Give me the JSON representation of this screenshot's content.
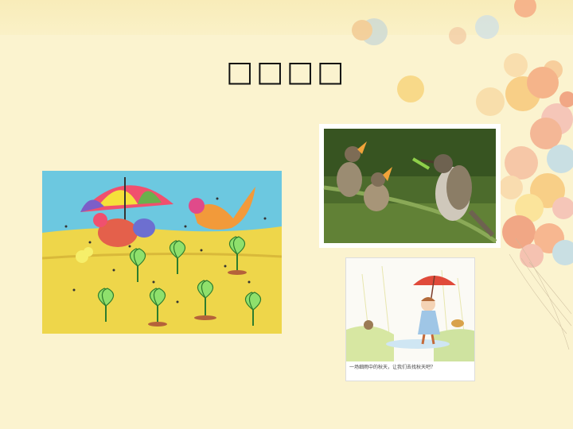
{
  "slide": {
    "title": "□□□□",
    "colors": {
      "background": "#fbf3cf",
      "band": "#f8ecb9",
      "bokeh": [
        "#f6a37c",
        "#f7c470",
        "#fbe08a",
        "#b9d9ea",
        "#f4b7b1",
        "#ee8e6d"
      ]
    }
  },
  "images": {
    "drawing": {
      "description_icon": "rainy-sprouts-drawing-icon"
    },
    "birds": {
      "description_icon": "bird-feeding-chicks-photo-icon"
    },
    "girl": {
      "description_icon": "girl-with-umbrella-illustration-icon",
      "caption": "一场细雨中的秋天，让我们去找秋天吧？"
    }
  }
}
